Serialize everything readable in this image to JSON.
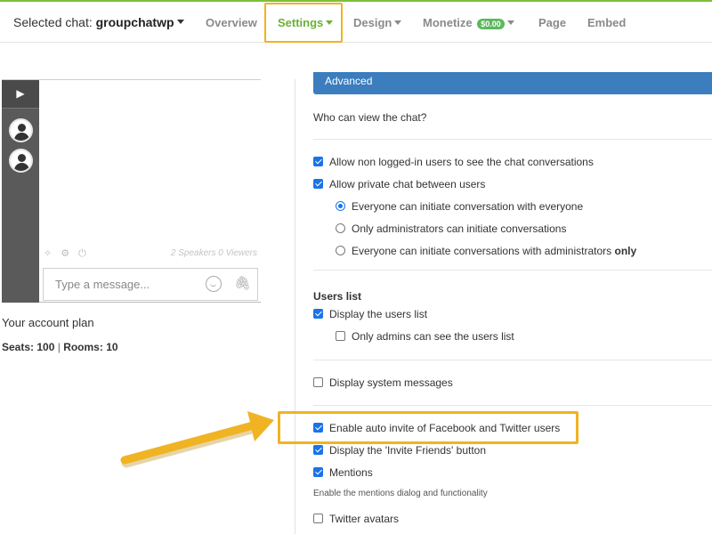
{
  "nav": {
    "selected_label": "Selected chat:",
    "selected_chat": "groupchatwp",
    "overview": "Overview",
    "settings": "Settings",
    "design": "Design",
    "monetize": "Monetize",
    "monetize_badge": "$0.00",
    "page": "Page",
    "embed": "Embed"
  },
  "chat_widget": {
    "play_icon": "play-icon",
    "speakers_viewers": "2 Speakers 0 Viewers",
    "message_placeholder": "Type a message..."
  },
  "account": {
    "plan_title": "Your account plan",
    "seats_label": "Seats: 100",
    "separator": "|",
    "rooms_label": "Rooms: 10"
  },
  "settings": {
    "section_tab": "Advanced",
    "who_can_view": "Who can view the chat?",
    "allow_non_logged": "Allow non logged-in users to see the chat conversations",
    "allow_private": "Allow private chat between users",
    "radio_everyone": "Everyone can initiate conversation with everyone",
    "radio_admins": "Only administrators can initiate conversations",
    "radio_with_admins_prefix": "Everyone can initiate conversations with administrators",
    "radio_with_admins_suffix": "only",
    "users_list_heading": "Users list",
    "display_users_list": "Display the users list",
    "only_admins_users_list": "Only admins can see the users list",
    "display_system_messages": "Display system messages",
    "auto_invite": "Enable auto invite of Facebook and Twitter users",
    "invite_friends": "Display the 'Invite Friends' button",
    "mentions": "Mentions",
    "mentions_hint": "Enable the mentions dialog and functionality",
    "twitter_avatars": "Twitter avatars"
  },
  "colors": {
    "accent_green": "#6cb037",
    "highlight_yellow": "#f0b323",
    "blue_bar": "#3b7dbd",
    "checkbox_blue": "#1a73e8"
  }
}
